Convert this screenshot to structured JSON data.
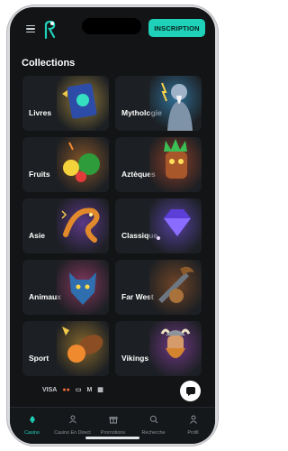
{
  "header": {
    "cta_label": "INSCRIPTION",
    "menu_icon": "hamburger-menu-icon",
    "logo_icon": "brand-logo-icon"
  },
  "page": {
    "title": "Collections"
  },
  "collections": [
    {
      "label": "Livres",
      "icon": "book-art"
    },
    {
      "label": "Mythologie",
      "icon": "zeus-art"
    },
    {
      "label": "Fruits",
      "icon": "fruits-art"
    },
    {
      "label": "Aztèques",
      "icon": "aztec-mask-art"
    },
    {
      "label": "Asie",
      "icon": "dragon-art"
    },
    {
      "label": "Classique",
      "icon": "diamond-art"
    },
    {
      "label": "Animaux",
      "icon": "wolf-art"
    },
    {
      "label": "Far West",
      "icon": "cowboy-art"
    },
    {
      "label": "Sport",
      "icon": "sports-balls-art"
    },
    {
      "label": "Vikings",
      "icon": "viking-art"
    }
  ],
  "payments": [
    "VISA",
    "●●",
    "▭",
    "M",
    "▦"
  ],
  "nav": [
    {
      "label": "Casino",
      "icon": "spade-icon",
      "active": true
    },
    {
      "label": "Casino En Direct",
      "icon": "dealer-icon",
      "active": false
    },
    {
      "label": "Promotions",
      "icon": "gift-icon",
      "active": false
    },
    {
      "label": "Recherche",
      "icon": "search-icon",
      "active": false
    },
    {
      "label": "Profil",
      "icon": "user-icon",
      "active": false
    }
  ],
  "colors": {
    "accent": "#1fd1b8",
    "background": "#121416",
    "card": "#1c1f23"
  }
}
